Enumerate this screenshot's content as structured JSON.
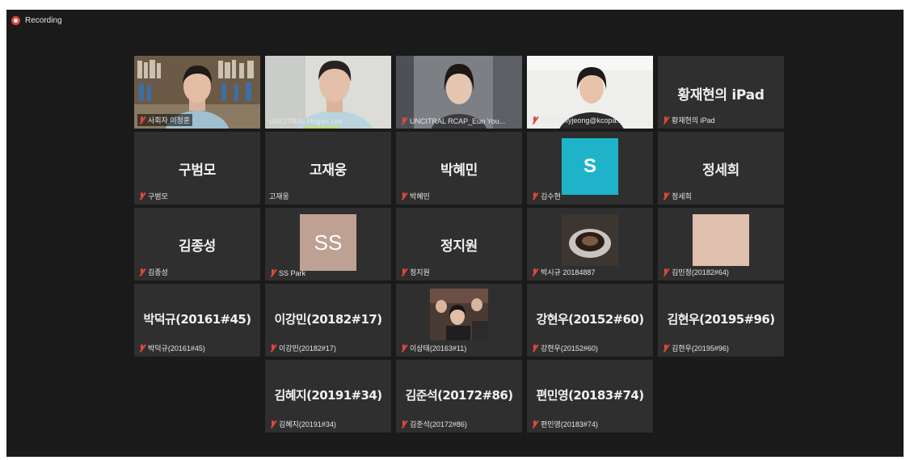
{
  "recording": {
    "label": "Recording"
  },
  "colors": {
    "mic_muted": "#e0473b",
    "active_speaker_border": "#c7e04a",
    "avatar_s": "#1fb3c9",
    "avatar_ss": "#bfa193",
    "avatar_blank": "#e0bfae"
  },
  "participants": [
    {
      "id": "p1",
      "label": "사회자 이정훈",
      "muted": true,
      "video": true,
      "active": true
    },
    {
      "id": "p2",
      "label": "UNCITRAL Hogan Lee",
      "muted": false,
      "video": true
    },
    {
      "id": "p3",
      "label": "UNCITRAL RCAP_Eun You...",
      "muted": true,
      "video": true
    },
    {
      "id": "p4",
      "label": "정성희(lilyjeong@kcopa...",
      "muted": true,
      "video": true
    },
    {
      "id": "p5",
      "label": "황재현의 iPad",
      "big": "황재현의 iPad",
      "muted": true
    },
    {
      "id": "p6",
      "label": "구범모",
      "big": "구범모",
      "muted": true
    },
    {
      "id": "p7",
      "label": "고재웅",
      "big": "고재웅",
      "muted": false
    },
    {
      "id": "p8",
      "label": "박혜민",
      "big": "박혜민",
      "muted": true
    },
    {
      "id": "p9",
      "label": "김수현",
      "avatar": "S",
      "muted": true
    },
    {
      "id": "p10",
      "label": "정세희",
      "big": "정세희",
      "muted": true
    },
    {
      "id": "p11",
      "label": "김종성",
      "big": "김종성",
      "muted": true
    },
    {
      "id": "p12",
      "label": "SS Park",
      "avatar": "SS",
      "muted": true
    },
    {
      "id": "p13",
      "label": "정지원",
      "big": "정지원",
      "muted": true
    },
    {
      "id": "p14",
      "label": "박시규 20184887",
      "muted": true,
      "photo": "coffee"
    },
    {
      "id": "p15",
      "label": "김민정(20182#64)",
      "muted": true,
      "photo": "blank"
    },
    {
      "id": "p16",
      "label": "박덕규(20161#45)",
      "big": "박덕규(20161#45)",
      "muted": true
    },
    {
      "id": "p17",
      "label": "이강민(20182#17)",
      "big": "이강민(20182#17)",
      "muted": true
    },
    {
      "id": "p18",
      "label": "이상태(20163#11)",
      "muted": true,
      "photo": "group"
    },
    {
      "id": "p19",
      "label": "강현우(20152#60)",
      "big": "강현우(20152#60)",
      "muted": true
    },
    {
      "id": "p20",
      "label": "김현우(20195#96)",
      "big": "김현우(20195#96)",
      "muted": true
    },
    {
      "id": "p21",
      "label": "김혜지(20191#34)",
      "big": "김혜지(20191#34)",
      "muted": true
    },
    {
      "id": "p22",
      "label": "김준석(20172#86)",
      "big": "김준석(20172#86)",
      "muted": true
    },
    {
      "id": "p23",
      "label": "편민영(20183#74)",
      "big": "편민영(20183#74)",
      "muted": true
    }
  ]
}
